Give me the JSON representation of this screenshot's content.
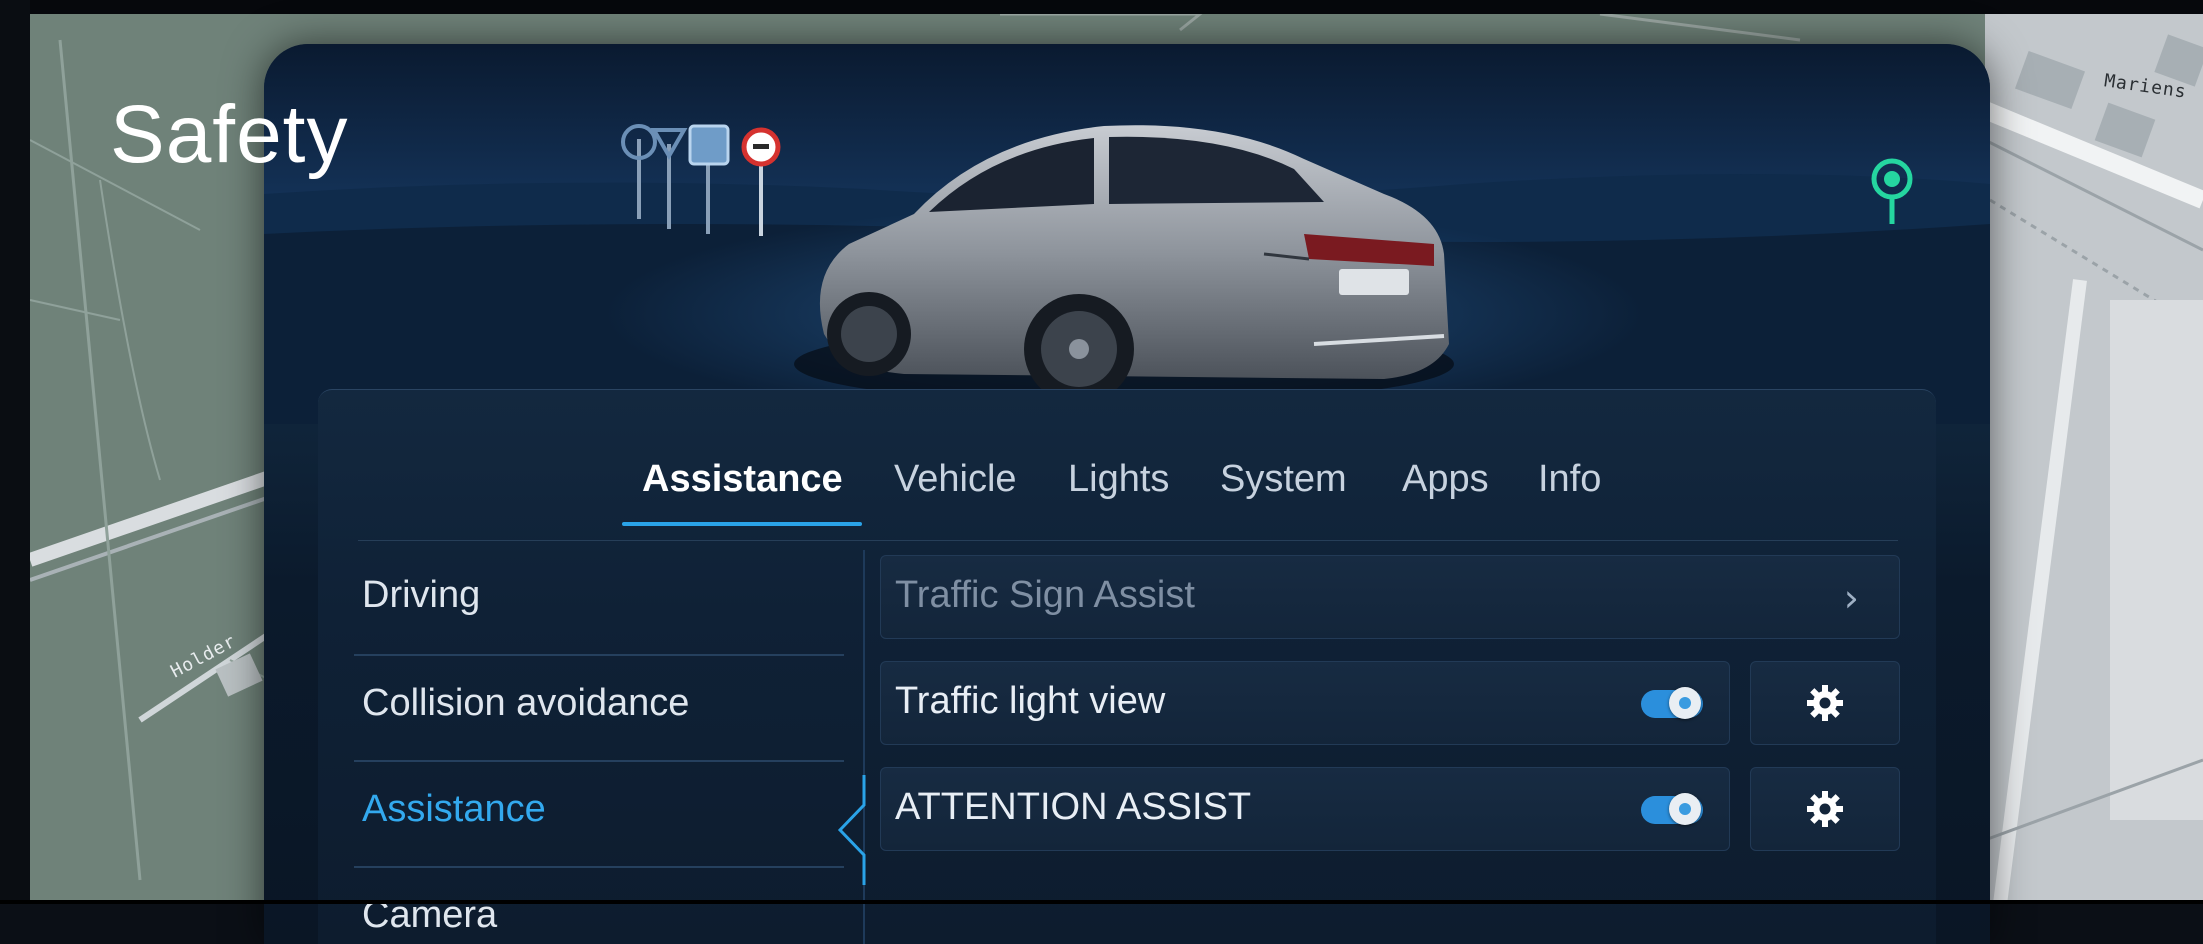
{
  "page_title": "Safety",
  "map": {
    "street_labels": [
      "Mariens",
      "Holder"
    ]
  },
  "tabs": [
    {
      "label": "Assistance",
      "active": true
    },
    {
      "label": "Vehicle",
      "active": false
    },
    {
      "label": "Lights",
      "active": false
    },
    {
      "label": "System",
      "active": false
    },
    {
      "label": "Apps",
      "active": false
    },
    {
      "label": "Info",
      "active": false
    }
  ],
  "sidebar": {
    "items": [
      {
        "label": "Driving",
        "active": false
      },
      {
        "label": "Collision avoidance",
        "active": false
      },
      {
        "label": "Assistance",
        "active": true
      },
      {
        "label": "Camera",
        "active": false
      }
    ]
  },
  "settings": {
    "traffic_sign_assist": {
      "label": "Traffic Sign Assist",
      "enabled": false,
      "icon": "chevron-right-icon",
      "chevron": "›"
    },
    "traffic_light_view": {
      "label": "Traffic light view",
      "toggle_on": true,
      "icon": "gear-icon"
    },
    "attention_assist": {
      "label": "ATTENTION ASSIST",
      "toggle_on": true,
      "icon": "gear-icon"
    }
  },
  "colors": {
    "accent": "#2aa3e8",
    "active_text": "#33a9ee",
    "panel_bg": "#0f2136",
    "poi_green": "#25d6a0"
  }
}
